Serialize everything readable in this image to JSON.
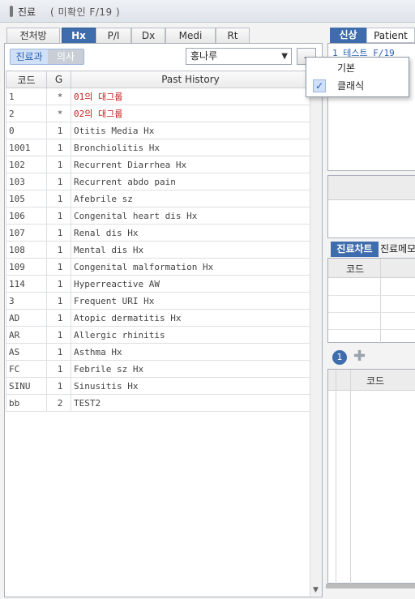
{
  "titlebar": {
    "title": "진료",
    "subtitle": "( 미확인 F/19 )"
  },
  "left_tabs": [
    "전처방",
    "Hx",
    "P/I",
    "Dx",
    "Medi",
    "Rt"
  ],
  "active_left_tab": "Hx",
  "toggle": {
    "on": "진료과",
    "off": "의사"
  },
  "combo": {
    "value": "홍나루"
  },
  "dots_button": "..",
  "table": {
    "headers": [
      "코드",
      "G",
      "Past History"
    ],
    "rows": [
      {
        "code": "1",
        "g": "*",
        "history": "01의 대그룹",
        "red": true
      },
      {
        "code": "2",
        "g": "*",
        "history": "02의 대그룹",
        "red": true
      },
      {
        "code": "0",
        "g": "1",
        "history": "Otitis Media Hx"
      },
      {
        "code": "1001",
        "g": "1",
        "history": "Bronchiolitis Hx"
      },
      {
        "code": "102",
        "g": "1",
        "history": "Recurrent Diarrhea Hx"
      },
      {
        "code": "103",
        "g": "1",
        "history": "Recurrent abdo pain"
      },
      {
        "code": "105",
        "g": "1",
        "history": "Afebrile sz"
      },
      {
        "code": "106",
        "g": "1",
        "history": "Congenital heart dis Hx"
      },
      {
        "code": "107",
        "g": "1",
        "history": "Renal dis Hx"
      },
      {
        "code": "108",
        "g": "1",
        "history": "Mental dis Hx"
      },
      {
        "code": "109",
        "g": "1",
        "history": "Congenital malformation Hx"
      },
      {
        "code": "114",
        "g": "1",
        "history": "Hyperreactive AW"
      },
      {
        "code": "3",
        "g": "1",
        "history": "Frequent URI Hx"
      },
      {
        "code": "AD",
        "g": "1",
        "history": "Atopic dermatitis Hx"
      },
      {
        "code": "AR",
        "g": "1",
        "history": "Allergic rhinitis"
      },
      {
        "code": "AS",
        "g": "1",
        "history": "Asthma Hx"
      },
      {
        "code": "FC",
        "g": "1",
        "history": "Febrile sz Hx"
      },
      {
        "code": "SINU",
        "g": "1",
        "history": "Sinusitis Hx"
      },
      {
        "code": "bb",
        "g": "2",
        "history": "TEST2"
      }
    ]
  },
  "right": {
    "tabs": [
      "신상",
      "Patient"
    ],
    "patient_row": "1 테스트 F/19",
    "bottom_tabs": [
      "진료차트",
      "진료메모"
    ],
    "grid1_header": "코드",
    "badge": "1",
    "grid2_header": "코드"
  },
  "popup": {
    "items": [
      {
        "label": "기본",
        "checked": false
      },
      {
        "label": "클래식",
        "checked": true
      }
    ]
  },
  "colors": {
    "accent": "#3f6cad",
    "red_text": "#c21b1b"
  }
}
